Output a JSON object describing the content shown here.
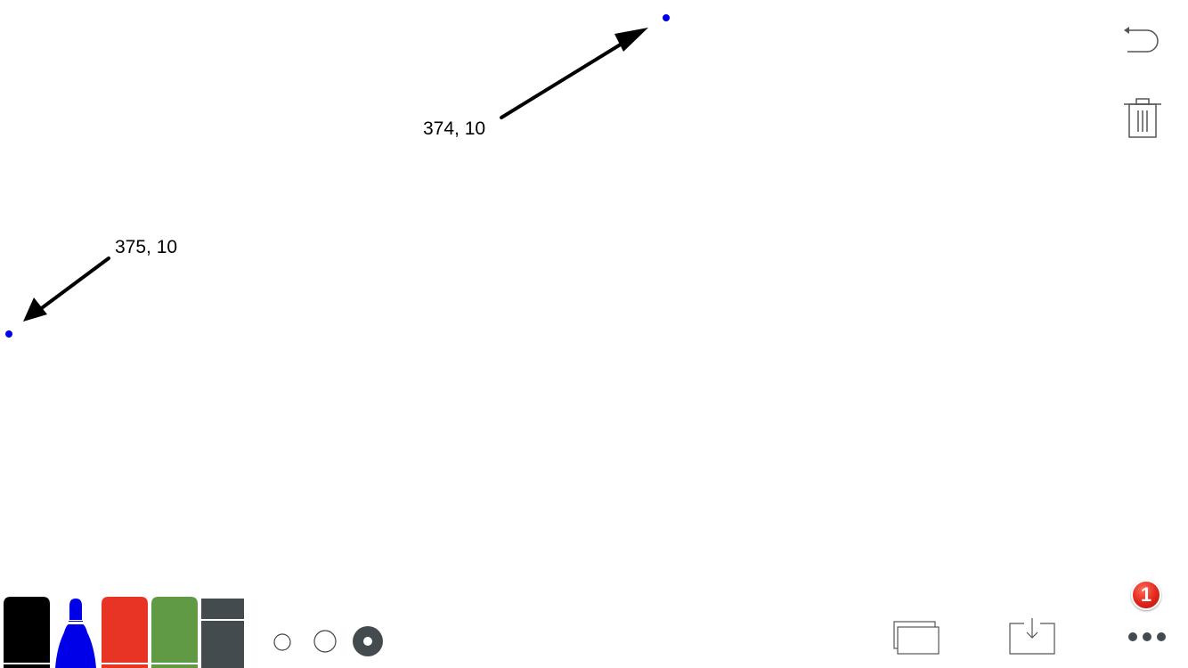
{
  "canvas": {
    "annotations": [
      {
        "label": "374, 10"
      },
      {
        "label": "375, 10"
      }
    ],
    "dot_color": "#0000e8"
  },
  "toolbar_right": {
    "undo_icon": "undo-icon",
    "trash_icon": "trash-icon"
  },
  "bottom_toolbar": {
    "markers": [
      {
        "name": "black-marker",
        "color": "#000000"
      },
      {
        "name": "blue-marker",
        "color": "#0000e8",
        "selected": true
      },
      {
        "name": "red-marker",
        "color": "#e83424"
      },
      {
        "name": "green-marker",
        "color": "#619a45"
      },
      {
        "name": "eraser",
        "color": "#444b4e"
      }
    ],
    "brush_sizes": [
      "small",
      "medium",
      "large"
    ],
    "selected_brush_size": "large",
    "pages_icon": "pages-icon",
    "export_icon": "export-icon",
    "more_icon": "more-icon",
    "notification_count": "1"
  }
}
